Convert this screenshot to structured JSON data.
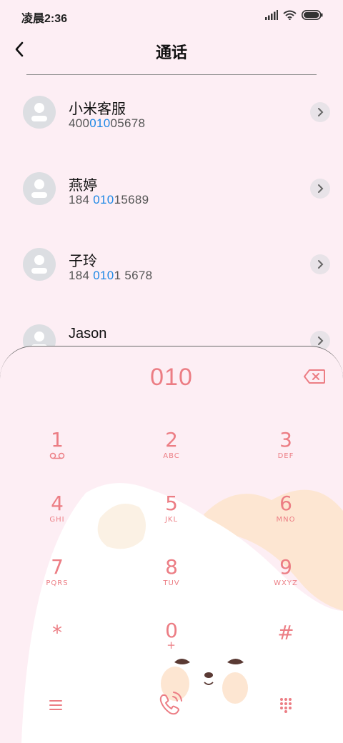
{
  "status": {
    "time": "凌晨2:36"
  },
  "header": {
    "title": "通话"
  },
  "contacts": [
    {
      "name": "小米客服",
      "number_pre": "400",
      "number_hl": "010",
      "number_post": "05678"
    },
    {
      "name": "燕婷",
      "number_pre": "184 ",
      "number_hl": "010",
      "number_post": "15689"
    },
    {
      "name": "子玲",
      "number_pre": "184 ",
      "number_hl": "010",
      "number_post": "1 5678"
    },
    {
      "name": "Jason",
      "number_pre": "",
      "number_hl": "",
      "number_post": ""
    }
  ],
  "dialer": {
    "display": "010",
    "keys": [
      {
        "digit": "1",
        "letters": "voicemail"
      },
      {
        "digit": "2",
        "letters": "ABC"
      },
      {
        "digit": "3",
        "letters": "DEF"
      },
      {
        "digit": "4",
        "letters": "GHI"
      },
      {
        "digit": "5",
        "letters": "JKL"
      },
      {
        "digit": "6",
        "letters": "MNO"
      },
      {
        "digit": "7",
        "letters": "PQRS"
      },
      {
        "digit": "8",
        "letters": "TUV"
      },
      {
        "digit": "9",
        "letters": "WXYZ"
      },
      {
        "digit": "*",
        "letters": ""
      },
      {
        "digit": "0",
        "letters": "+"
      },
      {
        "digit": "#",
        "letters": ""
      }
    ]
  },
  "colors": {
    "accent": "#ec7d84",
    "highlight": "#1e88e5",
    "background": "#fdeef4"
  },
  "icons": [
    "back-icon",
    "signal-icon",
    "wifi-icon",
    "battery-icon",
    "chevron-right-icon",
    "backspace-icon",
    "menu-icon",
    "call-icon",
    "keypad-icon"
  ]
}
